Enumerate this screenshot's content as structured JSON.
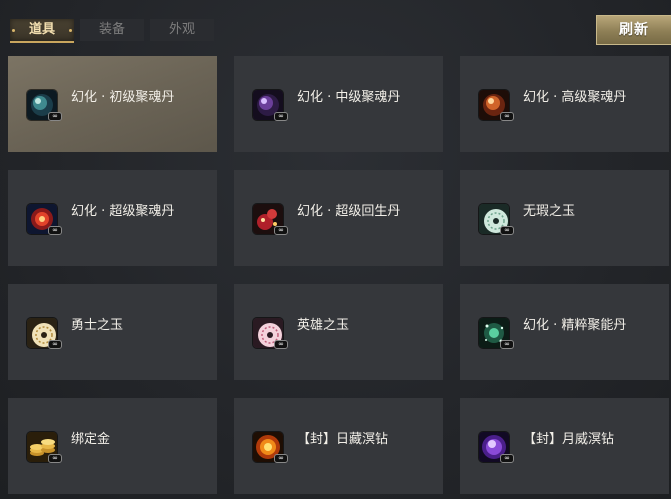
{
  "tabs": [
    {
      "label": "道具",
      "active": true
    },
    {
      "label": "装备",
      "active": false
    },
    {
      "label": "外观",
      "active": false
    }
  ],
  "refresh_label": "刷新",
  "colors": {
    "accent_gold": "#c9a65e",
    "card_bg": "#35373b",
    "card_selected_bg": "#6b6456"
  },
  "items": [
    {
      "name": "幻化 · 初级聚魂丹",
      "icon": "teal-dark-orb-icon",
      "selected": true
    },
    {
      "name": "幻化 · 中级聚魂丹",
      "icon": "purple-dark-orb-icon",
      "selected": false
    },
    {
      "name": "幻化 · 高级聚魂丹",
      "icon": "orange-red-orb-icon",
      "selected": false
    },
    {
      "name": "幻化 · 超级聚魂丹",
      "icon": "red-glowing-orb-icon",
      "selected": false
    },
    {
      "name": "幻化 · 超级回生丹",
      "icon": "red-gourd-icon",
      "selected": false
    },
    {
      "name": "无瑕之玉",
      "icon": "jade-disc-icon",
      "selected": false
    },
    {
      "name": "勇士之玉",
      "icon": "gold-jade-disc-icon",
      "selected": false
    },
    {
      "name": "英雄之玉",
      "icon": "pink-jade-disc-icon",
      "selected": false
    },
    {
      "name": "幻化 · 精粹聚能丹",
      "icon": "green-sparkle-orb-icon",
      "selected": false
    },
    {
      "name": "绑定金",
      "icon": "gold-coins-icon",
      "selected": false
    },
    {
      "name": "【封】日藏溟钻",
      "icon": "sun-gem-icon",
      "selected": false
    },
    {
      "name": "【封】月威溟钻",
      "icon": "purple-moon-gem-icon",
      "selected": false
    }
  ]
}
